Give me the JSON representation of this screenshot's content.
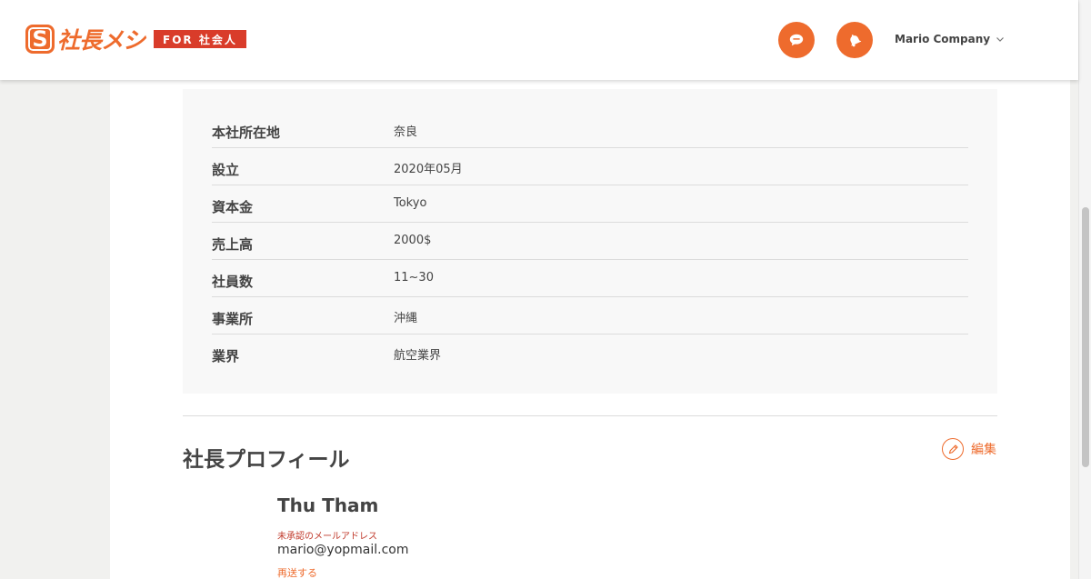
{
  "header": {
    "logo_mark": "S",
    "logo_text": "社長メシ",
    "logo_badge": "FOR 社会人",
    "company_name": "Mario Company"
  },
  "company_info": {
    "rows": [
      {
        "label": "本社所在地",
        "value": "奈良"
      },
      {
        "label": "設立",
        "value": "2020年05月"
      },
      {
        "label": "資本金",
        "value": "Tokyo"
      },
      {
        "label": "売上高",
        "value": "2000$"
      },
      {
        "label": "社員数",
        "value": "11~30"
      },
      {
        "label": "事業所",
        "value": "沖縄"
      },
      {
        "label": "業界",
        "value": "航空業界"
      }
    ]
  },
  "profile": {
    "section_title": "社長プロフィール",
    "edit_label": "編集",
    "name": "Thu Tham",
    "unverified_label": "未承認のメールアドレス",
    "email": "mario@yopmail.com",
    "resend_label": "再送する"
  },
  "colors": {
    "accent": "#ee6b2d",
    "badge_red": "#d93c2a",
    "warning_red": "#c0392b"
  },
  "icons": {
    "chat": "chat-bubble-icon",
    "bell": "bell-icon",
    "chevron": "chevron-down-icon",
    "edit": "pencil-icon"
  }
}
